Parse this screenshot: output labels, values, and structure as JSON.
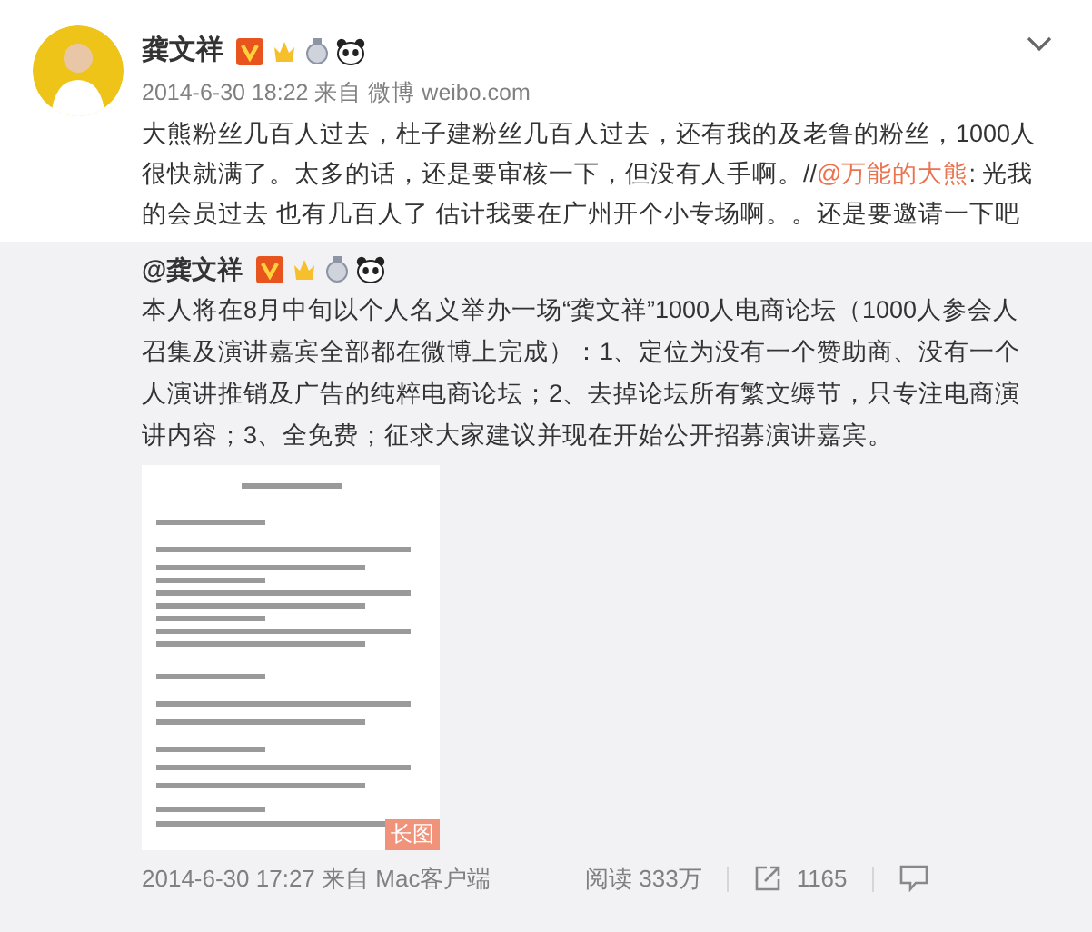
{
  "post": {
    "author": "龚文祥",
    "meta": "2014-6-30 18:22 来自 微博 weibo.com",
    "text_before": "大熊粉丝几百人过去，杜子建粉丝几百人过去，还有我的及老鲁的粉丝，1000人很快就满了。太多的话，还是要审核一下，但没有人手啊。//",
    "mention": "@万能的大熊",
    "text_after": ": 光我的会员过去 也有几百人了 估计我要在广州开个小专场啊。。还是要邀请一下吧"
  },
  "repost": {
    "author": "@龚文祥",
    "text": "本人将在8月中旬以个人名义举办一场“龚文祥”1000人电商论坛（1000人参会人召集及演讲嘉宾全部都在微博上完成）：1、定位为没有一个赞助商、没有一个人演讲推销及广告的纯粹电商论坛；2、去掉论坛所有繁文缛节，只专注电商演讲内容；3、全免费；征求大家建议并现在开始公开招募演讲嘉宾。",
    "image": {
      "kind": "picture",
      "badge": "长图"
    },
    "meta": "2014-6-30 17:27 来自 Mac客户端",
    "reads": "阅读 333万",
    "reposts": "1165"
  }
}
